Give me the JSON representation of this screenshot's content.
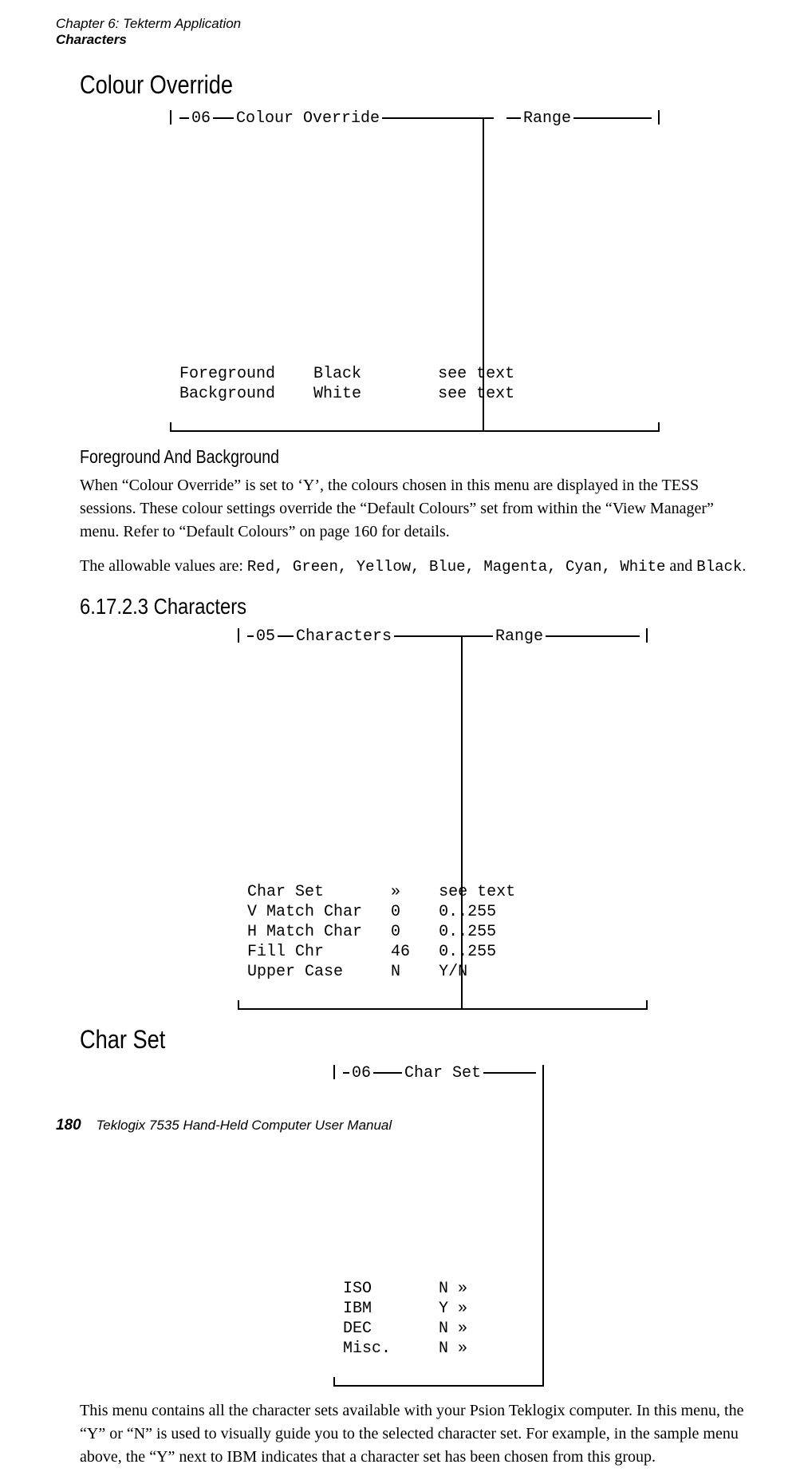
{
  "header": {
    "chapter": "Chapter 6: Tekterm Application",
    "section": "Characters"
  },
  "h_colour_override": "Colour Override",
  "menu_colour": {
    "level": "06",
    "title": "Colour Override",
    "range_label": "Range",
    "rows": [
      {
        "label": "Foreground",
        "value": "Black",
        "range": "see text"
      },
      {
        "label": "Background",
        "value": "White",
        "range": "see text"
      }
    ]
  },
  "h_fg_bg": "Foreground And Background",
  "para_fg_bg": "When “Colour Override” is set to ‘Y’, the colours chosen in this menu are displayed in the TESS sessions. These colour settings override the “Default Colours” set from within the “View Manager” menu. Refer to “Default Colours” on page 160 for details.",
  "para_allow_pre": "The allowable values are: ",
  "allow_values": "Red, Green, Yellow, Blue, Magenta, Cyan, White",
  "para_allow_join": " and ",
  "allow_last": "Black",
  "para_allow_end": ".",
  "h_characters": "6.17.2.3   Characters",
  "menu_chars": {
    "level": "05",
    "title": "Characters",
    "range_label": "Range",
    "rows": [
      {
        "label": "Char Set",
        "value": "»",
        "range": "see text"
      },
      {
        "label": "V Match Char",
        "value": "0",
        "range": "0..255"
      },
      {
        "label": "H Match Char",
        "value": "0",
        "range": "0..255"
      },
      {
        "label": "Fill Chr",
        "value": "46",
        "range": "0..255"
      },
      {
        "label": "Upper Case",
        "value": "N",
        "range": "Y/N"
      }
    ]
  },
  "h_char_set": "Char Set",
  "menu_charset": {
    "level": "06",
    "title": "Char Set",
    "rows": [
      {
        "label": "ISO",
        "value": "N »"
      },
      {
        "label": "IBM",
        "value": "Y »"
      },
      {
        "label": "DEC",
        "value": "N »"
      },
      {
        "label": "Misc.",
        "value": "N »"
      }
    ]
  },
  "para_charset": "This menu contains all the character sets available with your Psion Teklogix computer. In this menu, the “Y” or “N” is used to visually guide you to the selected character set. For example, in the sample menu above, the “Y” next to IBM indicates that a character set has been chosen from this group.",
  "footer": {
    "page": "180",
    "book": "Teklogix 7535 Hand-Held Computer User Manual"
  }
}
